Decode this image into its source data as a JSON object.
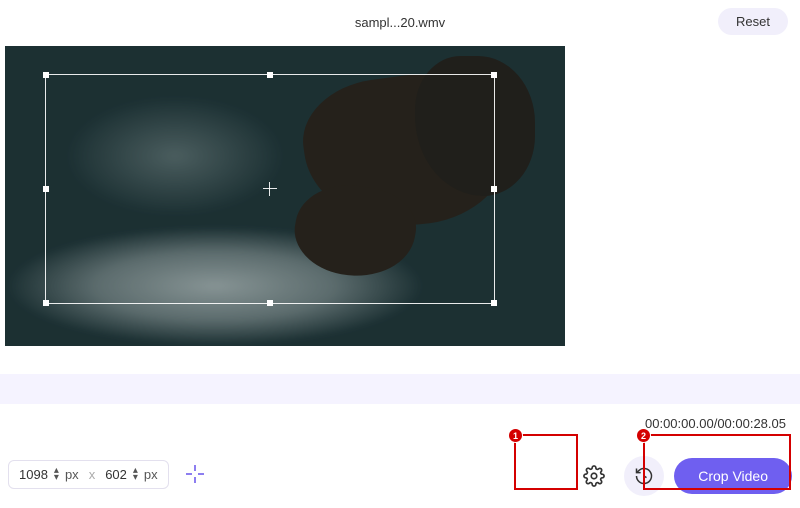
{
  "header": {
    "file_name": "sampl...20.wmv",
    "reset_label": "Reset"
  },
  "dimensions": {
    "width": "1098",
    "height": "602",
    "unit": "px",
    "separator": "x"
  },
  "timecode": {
    "current": "00:00:00.00",
    "total": "00:00:28.05"
  },
  "actions": {
    "crop_label": "Crop Video"
  },
  "annotations": {
    "badge1": "1",
    "badge2": "2"
  },
  "icons": {
    "gear": "gear-icon",
    "history": "history-icon",
    "aspect": "aspect-ratio-icon"
  }
}
